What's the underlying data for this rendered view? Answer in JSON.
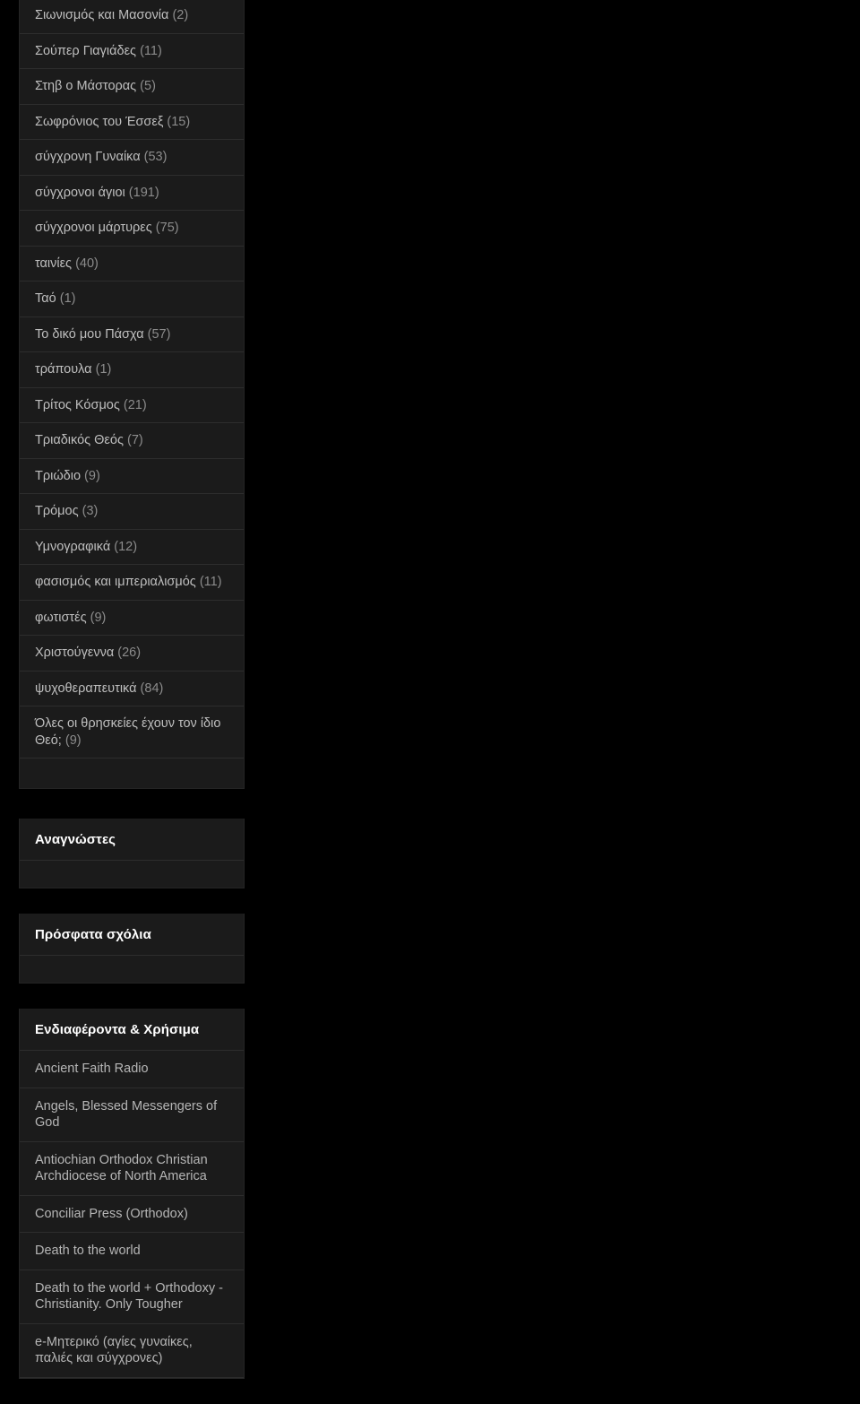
{
  "page": {
    "background_color": "#000000",
    "widget_background": "#1b1b1b",
    "divider_color": "#2d2d2d",
    "text_color": "#bfbfbf",
    "count_color": "#8c8c8c",
    "heading_color": "#ffffff"
  },
  "labels_widget": {
    "items": [
      {
        "name": "Σιωνισμός και Μασονία",
        "count": "(2)"
      },
      {
        "name": "Σούπερ Γιαγιάδες",
        "count": "(11)"
      },
      {
        "name": "Στηβ ο Μάστορας",
        "count": "(5)"
      },
      {
        "name": "Σωφρόνιος του Έσσεξ",
        "count": "(15)"
      },
      {
        "name": "σύγχρονη Γυναίκα",
        "count": "(53)"
      },
      {
        "name": "σύγχρονοι άγιοι",
        "count": "(191)"
      },
      {
        "name": "σύγχρονοι μάρτυρες",
        "count": "(75)"
      },
      {
        "name": "ταινίες",
        "count": "(40)"
      },
      {
        "name": "Ταό",
        "count": "(1)"
      },
      {
        "name": "Το δικό μου Πάσχα",
        "count": "(57)"
      },
      {
        "name": "τράπουλα",
        "count": "(1)"
      },
      {
        "name": "Τρίτος Κόσμος",
        "count": "(21)"
      },
      {
        "name": "Τριαδικός Θεός",
        "count": "(7)"
      },
      {
        "name": "Τριώδιο",
        "count": "(9)"
      },
      {
        "name": "Τρόμος",
        "count": "(3)"
      },
      {
        "name": "Υμνογραφικά",
        "count": "(12)"
      },
      {
        "name": "φασισμός και ιμπεριαλισμός",
        "count": "(11)"
      },
      {
        "name": "φωτιστές",
        "count": "(9)"
      },
      {
        "name": "Χριστούγεννα",
        "count": "(26)"
      },
      {
        "name": "ψυχοθεραπευτικά",
        "count": "(84)"
      },
      {
        "name": "Όλες οι θρησκείες έχουν τον ίδιο Θεό;",
        "count": "(9)"
      }
    ]
  },
  "followers_widget": {
    "title": "Αναγνώστες"
  },
  "recent_comments_widget": {
    "title": "Πρόσφατα σχόλια"
  },
  "links_widget": {
    "title": "Ενδιαφέροντα & Χρήσιμα",
    "items": [
      {
        "label": "Ancient Faith Radio"
      },
      {
        "label": "Angels, Blessed Messengers of God"
      },
      {
        "label": "Antiochian Orthodox Christian Archdiocese of North America"
      },
      {
        "label": "Conciliar Press (Orthodox)"
      },
      {
        "label": "Death to the world"
      },
      {
        "label": "Death to the world + Orthodoxy - Christianity. Only Tougher"
      },
      {
        "label": "e-Μητερικό (αγίες γυναίκες, παλιές και σύγχρονες)"
      }
    ]
  }
}
